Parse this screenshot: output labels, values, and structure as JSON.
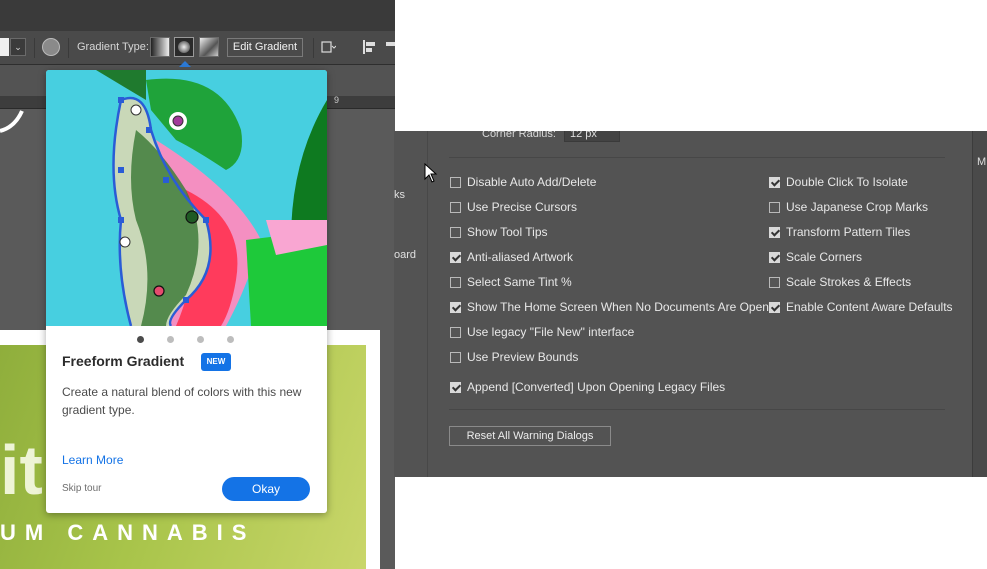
{
  "toolbar": {
    "gradient_type_label": "Gradient Type:",
    "edit_gradient_label": "Edit Gradient",
    "dropdown_glyph": "⌄"
  },
  "ruler": {
    "mark": "9"
  },
  "artboard": {
    "brand_text": "UM CANNABIS",
    "big_text": "it"
  },
  "tour_card": {
    "title": "Freeform Gradient",
    "badge": "NEW",
    "description": "Create a natural blend of colors with this new gradient type.",
    "learn_more": "Learn More",
    "skip": "Skip tour",
    "ok": "Okay",
    "page_count": 4,
    "current_page": 1
  },
  "prefs": {
    "sidebar_fragments": [
      "ks",
      "oard"
    ],
    "corner_radius_label": "Corner Radius:",
    "corner_radius_value": "12 px",
    "left_options": [
      {
        "label": "Disable Auto Add/Delete",
        "checked": false
      },
      {
        "label": "Use Precise Cursors",
        "checked": false
      },
      {
        "label": "Show Tool Tips",
        "checked": false
      },
      {
        "label": "Anti-aliased Artwork",
        "checked": true
      },
      {
        "label": "Select Same Tint %",
        "checked": false
      },
      {
        "label": "Show The Home Screen When No Documents Are Open",
        "checked": true
      },
      {
        "label": "Use legacy \"File New\" interface",
        "checked": false
      },
      {
        "label": "Use Preview Bounds",
        "checked": false
      }
    ],
    "append_option": {
      "label": "Append [Converted] Upon Opening Legacy Files",
      "checked": true
    },
    "right_options": [
      {
        "label": "Double Click To Isolate",
        "checked": true
      },
      {
        "label": "Use Japanese Crop Marks",
        "checked": false
      },
      {
        "label": "Transform Pattern Tiles",
        "checked": true
      },
      {
        "label": "Scale Corners",
        "checked": true
      },
      {
        "label": "Scale Strokes & Effects",
        "checked": false
      },
      {
        "label": "Enable Content Aware Defaults",
        "checked": true
      }
    ],
    "reset_button": "Reset All Warning Dialogs",
    "right_panel_letter": "M"
  },
  "colors": {
    "accent": "#1473e6",
    "dialog_bg": "#535353",
    "card_image_bg": "#47cfe0"
  }
}
